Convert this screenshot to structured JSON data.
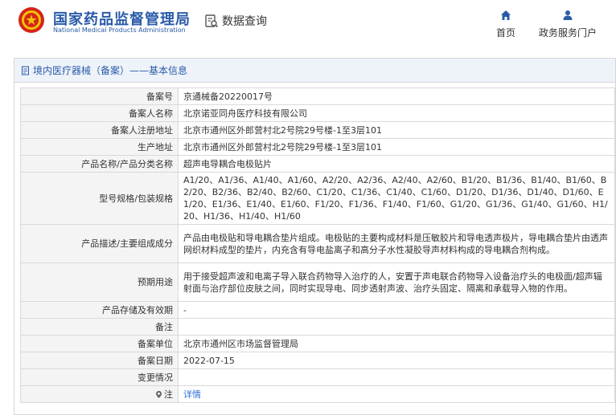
{
  "header": {
    "brand_cn": "国家药品监督管理局",
    "brand_en": "National Medical Products Administration",
    "query_label": "数据查询",
    "nav": [
      {
        "label": "首页",
        "icon": "home-icon"
      },
      {
        "label": "政务服务门户",
        "icon": "user-icon"
      }
    ]
  },
  "panel": {
    "title": "境内医疗器械（备案）——基本信息"
  },
  "rows": [
    {
      "label": "备案号",
      "value": "京通械备20220017号"
    },
    {
      "label": "备案人名称",
      "value": "北京诺亚同舟医疗科技有限公司"
    },
    {
      "label": "备案人注册地址",
      "value": "北京市通州区外郎营村北2号院29号楼-1至3层101"
    },
    {
      "label": "生产地址",
      "value": "北京市通州区外郎营村北2号院29号楼-1至3层101"
    },
    {
      "label": "产品名称/产品分类名称",
      "value": "超声电导耦合电极贴片"
    },
    {
      "label": "型号规格/包装规格",
      "value": "A1/20、A1/36、A1/40、A1/60、A2/20、A2/36、A2/40、A2/60、B1/20、B1/36、B1/40、B1/60、B2/20、B2/36、B2/40、B2/60、C1/20、C1/36、C1/40、C1/60、D1/20、D1/36、D1/40、D1/60、E1/20、E1/36、E1/40、E1/60、F1/20、F1/36、F1/40、F1/60、G1/20、G1/36、G1/40、G1/60、H1/20、H1/36、H1/40、H1/60"
    },
    {
      "label": "产品描述/主要组成成分",
      "value": "产品由电极贴和导电耦合垫片组成。电极贴的主要构成材料是压敏胶片和导电透声极片，导电耦合垫片由透声网织材料成型的垫片，内充含有导电盐离子和高分子水性凝胶导声材料构成的导电耦合剂构成。"
    },
    {
      "label": "预期用途",
      "value": "用于接受超声波和电离子导入联合药物导入治疗的人，安置于声电联合药物导入设备治疗头的电极面/超声辐射面与治疗部位皮肤之间，同时实现导电、同步透射声波、治疗头固定、隔离和承载导入物的作用。"
    },
    {
      "label": "产品存储及有效期",
      "value": "-"
    },
    {
      "label": "备注",
      "value": ""
    },
    {
      "label": "备案单位",
      "value": "北京市通州区市场监督管理局"
    },
    {
      "label": "备案日期",
      "value": "2022-07-15"
    },
    {
      "label": "变更情况",
      "value": ""
    },
    {
      "label": "注",
      "value": "详情"
    }
  ]
}
